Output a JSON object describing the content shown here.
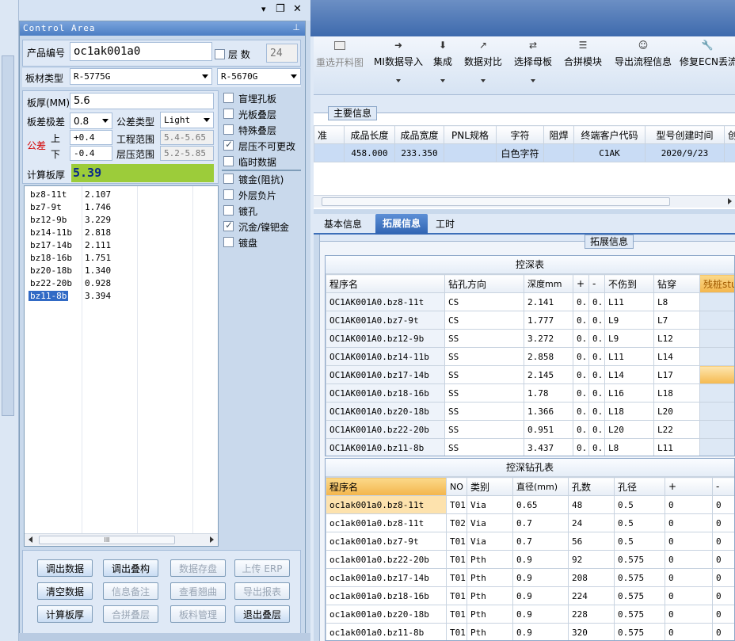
{
  "window_controls": {
    "pin": "▾",
    "restore": "❐",
    "close": "✕"
  },
  "control_area": {
    "title": "Control Area",
    "product_no_label": "产品编号",
    "product_no_value": "oc1ak001a0",
    "layers_label": "层  数",
    "layers_value": "24",
    "board_type_label": "板材类型",
    "board_type_value": "R-5775G",
    "board_type_value2": "R-5670G",
    "thickness_label": "板厚(MM)",
    "thickness_value": "5.6",
    "tol_grade_label": "板差极差",
    "tol_grade_value": "0.8",
    "tol_type_label": "公差类型",
    "tol_type_value": "Light",
    "tolerance_label": "公差",
    "upper_label": "上",
    "lower_label": "下",
    "upper_value": "+0.4",
    "lower_value": "-0.4",
    "eng_range_label": "工程范围",
    "eng_range_value": "5.4-5.65",
    "press_range_label": "层压范围",
    "press_range_value": "5.2-5.85",
    "calc_label": "计算板厚",
    "calc_value": "5.39",
    "options": [
      {
        "label": "盲埋孔板",
        "checked": false
      },
      {
        "label": "光板叠层",
        "checked": false
      },
      {
        "label": "特殊叠层",
        "checked": false
      },
      {
        "label": "层压不可更改",
        "checked": true
      },
      {
        "label": "临时数据",
        "checked": false
      }
    ],
    "options2": [
      {
        "label": "镀金(阻抗)",
        "checked": false
      },
      {
        "label": "外层负片",
        "checked": false
      },
      {
        "label": "镀孔",
        "checked": false
      },
      {
        "label": "沉金/镍钯金",
        "checked": true
      },
      {
        "label": "镀盘",
        "checked": false
      }
    ],
    "list": [
      {
        "name": "bz8-11t",
        "value": "2.107"
      },
      {
        "name": "bz7-9t",
        "value": "1.746"
      },
      {
        "name": "bz12-9b",
        "value": "3.229"
      },
      {
        "name": "bz14-11b",
        "value": "2.818"
      },
      {
        "name": "bz17-14b",
        "value": "2.111"
      },
      {
        "name": "bz18-16b",
        "value": "1.751"
      },
      {
        "name": "bz20-18b",
        "value": "1.340"
      },
      {
        "name": "bz22-20b",
        "value": "0.928"
      },
      {
        "name": "bz11-8b",
        "value": "3.394"
      }
    ],
    "scroll_grip": "III",
    "buttons": [
      {
        "label": "调出数据",
        "enabled": true
      },
      {
        "label": "调出叠构",
        "enabled": true
      },
      {
        "label": "数据存盘",
        "enabled": false
      },
      {
        "label": "上传 ERP",
        "enabled": false
      },
      {
        "label": "清空数据",
        "enabled": true
      },
      {
        "label": "信息备注",
        "enabled": false
      },
      {
        "label": "查看翘曲",
        "enabled": false
      },
      {
        "label": "导出报表",
        "enabled": false
      },
      {
        "label": "计算板厚",
        "enabled": true
      },
      {
        "label": "合拼叠层",
        "enabled": false
      },
      {
        "label": "板料管理",
        "enabled": false
      },
      {
        "label": "退出叠层",
        "enabled": true
      }
    ]
  },
  "toolbar": {
    "items": [
      {
        "label": "重选开料图",
        "icon": "image-icon"
      },
      {
        "label": "MI数据导入",
        "icon": "import-icon"
      },
      {
        "label": "集成",
        "icon": "download-icon"
      },
      {
        "label": "数据对比",
        "icon": "compare-icon"
      },
      {
        "label": "选择母板",
        "icon": "shuffle-icon"
      },
      {
        "label": "合拼模块",
        "icon": "list-icon"
      },
      {
        "label": "导出流程信息",
        "icon": "smile-icon"
      },
      {
        "label": "修复ECN丢流",
        "icon": "wrench-icon"
      }
    ]
  },
  "main_info": {
    "title": "主要信息",
    "headers": [
      "准",
      "成品长度",
      "成品宽度",
      "PNL规格",
      "字符",
      "阻焊",
      "终端客户代码",
      "型号创建时间",
      "创"
    ],
    "row": [
      "",
      "458.000",
      "233.350",
      "",
      "白色字符",
      "",
      "C1AK",
      "2020/9/23",
      ""
    ]
  },
  "tabs": [
    "基本信息",
    "拓展信息",
    "工时"
  ],
  "active_tab": "拓展信息",
  "ext_info_title": "拓展信息",
  "depth_table": {
    "title": "控深表",
    "headers": [
      "程序名",
      "钻孔方向",
      "深度mm",
      "+",
      "-",
      "不伤到",
      "钻穿",
      "残桩stu"
    ],
    "rows": [
      [
        "OC1AK001A0.bz8-11t",
        "CS",
        "2.141",
        "0..",
        "0..",
        "L11",
        "L8",
        ""
      ],
      [
        "OC1AK001A0.bz7-9t",
        "CS",
        "1.777",
        "0..",
        "0..",
        "L9",
        "L7",
        ""
      ],
      [
        "OC1AK001A0.bz12-9b",
        "SS",
        "3.272",
        "0..",
        "0..",
        "L9",
        "L12",
        ""
      ],
      [
        "OC1AK001A0.bz14-11b",
        "SS",
        "2.858",
        "0..",
        "0..",
        "L11",
        "L14",
        ""
      ],
      [
        "OC1AK001A0.bz17-14b",
        "SS",
        "2.145",
        "0..",
        "0..",
        "L14",
        "L17",
        ""
      ],
      [
        "OC1AK001A0.bz18-16b",
        "SS",
        "1.78",
        "0..",
        "0..",
        "L16",
        "L18",
        ""
      ],
      [
        "OC1AK001A0.bz20-18b",
        "SS",
        "1.366",
        "0..",
        "0..",
        "L18",
        "L20",
        ""
      ],
      [
        "OC1AK001A0.bz22-20b",
        "SS",
        "0.951",
        "0..",
        "0..",
        "L20",
        "L22",
        ""
      ],
      [
        "OC1AK001A0.bz11-8b",
        "SS",
        "3.437",
        "0..",
        "0..",
        "L8",
        "L11",
        ""
      ]
    ]
  },
  "drill_table": {
    "title": "控深钻孔表",
    "headers": [
      "程序名",
      "NO",
      "类别",
      "直径(mm)",
      "孔数",
      "孔径",
      "+",
      "-"
    ],
    "rows": [
      [
        "oc1ak001a0.bz8-11t",
        "T01",
        "Via",
        "0.65",
        "48",
        "0.5",
        "0",
        "0"
      ],
      [
        "oc1ak001a0.bz8-11t",
        "T02",
        "Via",
        "0.7",
        "24",
        "0.5",
        "0",
        "0"
      ],
      [
        "oc1ak001a0.bz7-9t",
        "T01",
        "Via",
        "0.7",
        "56",
        "0.5",
        "0",
        "0"
      ],
      [
        "oc1ak001a0.bz22-20b",
        "T01",
        "Pth",
        "0.9",
        "92",
        "0.575",
        "0",
        "0"
      ],
      [
        "oc1ak001a0.bz17-14b",
        "T01",
        "Pth",
        "0.9",
        "208",
        "0.575",
        "0",
        "0"
      ],
      [
        "oc1ak001a0.bz18-16b",
        "T01",
        "Pth",
        "0.9",
        "224",
        "0.575",
        "0",
        "0"
      ],
      [
        "oc1ak001a0.bz20-18b",
        "T01",
        "Pth",
        "0.9",
        "228",
        "0.575",
        "0",
        "0"
      ],
      [
        "oc1ak001a0.bz11-8b",
        "T01",
        "Pth",
        "0.9",
        "320",
        "0.575",
        "0",
        "0"
      ]
    ]
  },
  "colors": {
    "accent": "#3d6fb8",
    "header_orange": "#f7c46c",
    "calc_green": "#9ccc3a",
    "selection": "#316ac5"
  }
}
